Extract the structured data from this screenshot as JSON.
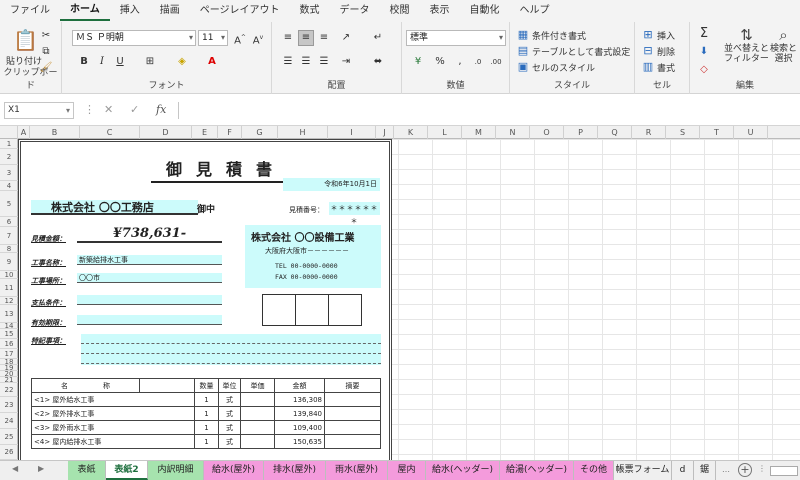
{
  "menu": {
    "tabs": [
      "ファイル",
      "ホーム",
      "挿入",
      "描画",
      "ページレイアウト",
      "数式",
      "データ",
      "校閲",
      "表示",
      "自動化",
      "ヘルプ"
    ],
    "active": "ホーム"
  },
  "ribbon": {
    "clipboard": {
      "paste": "貼り付け",
      "label": "クリップボード"
    },
    "font": {
      "name": "ＭＳ Ｐ明朝",
      "size": "11",
      "label": "フォント"
    },
    "alignment": {
      "label": "配置"
    },
    "number": {
      "format": "標準",
      "label": "数値"
    },
    "styles": {
      "conditional": "条件付き書式",
      "table": "テーブルとして書式設定",
      "cell_styles": "セルのスタイル",
      "label": "スタイル"
    },
    "cells": {
      "insert": "挿入",
      "delete": "削除",
      "format": "書式",
      "label": "セル"
    },
    "editing": {
      "sort_1": "並べ替えと",
      "sort_2": "フィルター",
      "find_1": "検索と",
      "find_2": "選択",
      "label": "編集"
    }
  },
  "formula_bar": {
    "cell_ref": "X1",
    "fx": "fx",
    "value": ""
  },
  "columns": [
    "A",
    "B",
    "C",
    "D",
    "E",
    "F",
    "G",
    "H",
    "I",
    "J",
    "K",
    "L",
    "M",
    "N",
    "O",
    "P",
    "Q",
    "R",
    "S",
    "T",
    "U"
  ],
  "rows": [
    "1",
    "2",
    "3",
    "4",
    "5",
    "6",
    "7",
    "8",
    "9",
    "10",
    "11",
    "12",
    "13",
    "14",
    "15",
    "16",
    "17",
    "18",
    "19",
    "20",
    "21",
    "22",
    "23",
    "24",
    "25",
    "26"
  ],
  "estimate": {
    "title": "御見積書",
    "date": "令和6年10月1日",
    "client": "株式会社 〇〇工務店",
    "honorific": "御中",
    "number_label": "見積番号：",
    "number_value": "＊＊＊＊＊＊＊",
    "amount_label": "見積金額：",
    "amount": "¥738,631-",
    "project_label": "工事名称：",
    "project": "新築給排水工事",
    "site_label": "工事場所：",
    "site": "〇〇市",
    "payment_label": "支払条件：",
    "validity_label": "有効期限：",
    "notes_label": "特記事項：",
    "company": {
      "name": "株式会社 〇〇設備工業",
      "address": "大阪府大阪市－－－－－－",
      "tel": "TEL  00-0000-0000",
      "fax": "FAX  00-0000-0000"
    },
    "table": {
      "headers": [
        "名　　　　　称",
        "数量",
        "単位",
        "単価",
        "金額",
        "摘要"
      ],
      "rows": [
        {
          "name": "<1> 屋外給水工事",
          "qty": "1",
          "unit": "式",
          "price": "",
          "amount": "136,308",
          "note": ""
        },
        {
          "name": "<2> 屋外排水工事",
          "qty": "1",
          "unit": "式",
          "price": "",
          "amount": "139,840",
          "note": ""
        },
        {
          "name": "<3> 屋外雨水工事",
          "qty": "1",
          "unit": "式",
          "price": "",
          "amount": "109,400",
          "note": ""
        },
        {
          "name": "<4> 屋内給排水工事",
          "qty": "1",
          "unit": "式",
          "price": "",
          "amount": "150,635",
          "note": ""
        }
      ]
    }
  },
  "sheets": [
    {
      "name": "表紙",
      "color": "green",
      "active": false
    },
    {
      "name": "表紙2",
      "color": "green",
      "active": true
    },
    {
      "name": "内訳明細",
      "color": "green",
      "active": false
    },
    {
      "name": "給水(屋外)",
      "color": "pink",
      "active": false
    },
    {
      "name": "排水(屋外)",
      "color": "pink",
      "active": false
    },
    {
      "name": "雨水(屋外)",
      "color": "pink",
      "active": false
    },
    {
      "name": "屋内",
      "color": "pink",
      "active": false
    },
    {
      "name": "給水(ヘッダー)",
      "color": "pink",
      "active": false
    },
    {
      "name": "給湯(ヘッダー)",
      "color": "pink",
      "active": false
    },
    {
      "name": "その他",
      "color": "pink",
      "active": false
    },
    {
      "name": "帳票フォーム",
      "color": "plain",
      "active": false
    },
    {
      "name": "d",
      "color": "plain",
      "active": false
    },
    {
      "name": "鋸",
      "color": "plain",
      "active": false
    }
  ],
  "colors": {
    "accent": "#1e6f3e",
    "cyan_fill": "#ccfbfb",
    "green_tab": "#a6e3ae",
    "pink_tab": "#f49bdc"
  }
}
